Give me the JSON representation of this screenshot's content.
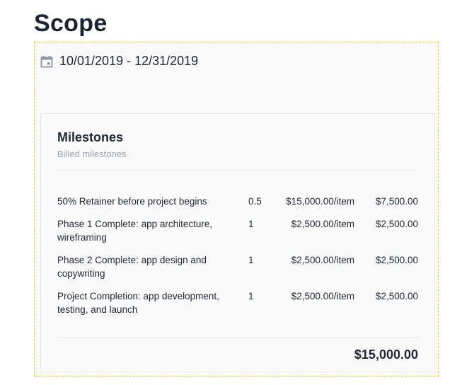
{
  "scope": {
    "title": "Scope",
    "date_range": "10/01/2019 - 12/31/2019",
    "icons": {
      "calendar": "calendar-icon"
    }
  },
  "milestones": {
    "title": "Milestones",
    "subtitle": "Billed milestones",
    "rows": [
      {
        "description": "50% Retainer before project begins",
        "quantity": "0.5",
        "rate": "$15,000.00/item",
        "amount": "$7,500.00"
      },
      {
        "description": "Phase 1 Complete: app architecture, wireframing",
        "quantity": "1",
        "rate": "$2,500.00/item",
        "amount": "$2,500.00"
      },
      {
        "description": "Phase 2 Complete: app design and copywriting",
        "quantity": "1",
        "rate": "$2,500.00/item",
        "amount": "$2,500.00"
      },
      {
        "description": "Project Completion: app development, testing, and launch",
        "quantity": "1",
        "rate": "$2,500.00/item",
        "amount": "$2,500.00"
      }
    ],
    "total": "$15,000.00"
  },
  "colors": {
    "frame_border": "#f1c232",
    "text": "#1f2733",
    "muted": "#9aa3ad",
    "icon": "#8c95a0"
  }
}
